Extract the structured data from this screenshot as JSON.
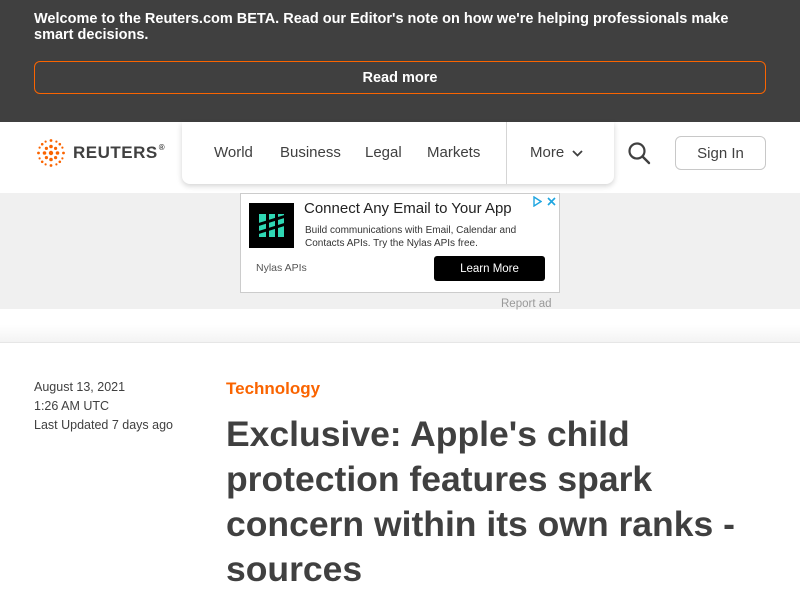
{
  "beta_banner": {
    "message": "Welcome to the Reuters.com BETA. Read our Editor's note on how we're helping professionals make smart decisions.",
    "button_label": "Read more"
  },
  "header": {
    "logo_text": "REUTERS",
    "logo_mark": "®",
    "nav": [
      {
        "label": "World"
      },
      {
        "label": "Business"
      },
      {
        "label": "Legal"
      },
      {
        "label": "Markets"
      }
    ],
    "more_label": "More",
    "search_icon": "search-icon",
    "sign_in_label": "Sign In"
  },
  "ad": {
    "title": "Connect Any Email to Your App",
    "body": "Build communications with Email, Calendar and Contacts APIs. Try the Nylas APIs free.",
    "brand": "Nylas APIs",
    "cta": "Learn More",
    "report_label": "Report ad"
  },
  "article": {
    "date": "August 13, 2021",
    "time": "1:26 AM UTC",
    "updated": "Last Updated 7 days ago",
    "category": "Technology",
    "headline": "Exclusive: Apple's child protection features spark concern within its own ranks -sources"
  },
  "colors": {
    "banner_bg": "#404040",
    "accent": "#fa6400",
    "text": "#404040"
  }
}
